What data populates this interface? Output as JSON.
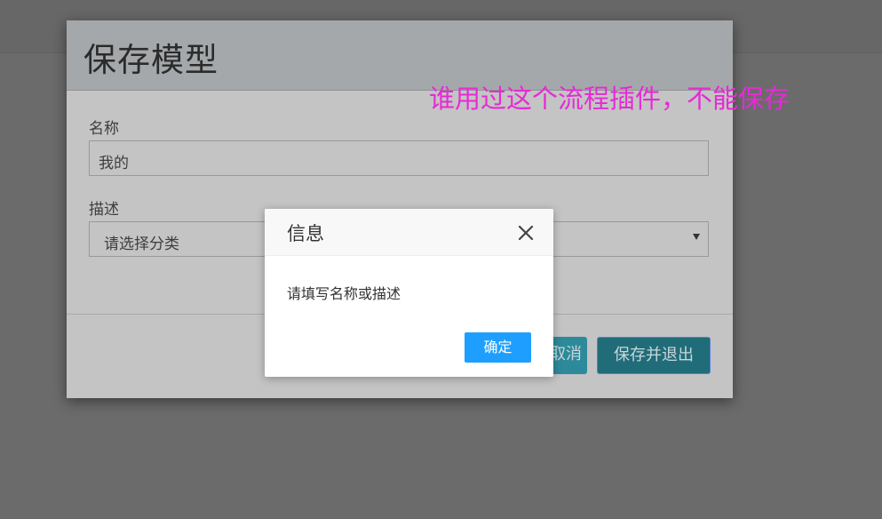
{
  "save_modal": {
    "title": "保存模型",
    "name_label": "名称",
    "name_value": "我的",
    "description_label": "描述",
    "category_select_value": "请选择分类",
    "cancel_label": "取消",
    "save_exit_label": "保存并退出"
  },
  "annotation": {
    "text": "谁用过这个流程插件，不能保存",
    "color": "#e62ad6"
  },
  "info_dialog": {
    "title": "信息",
    "close_icon": "close-icon",
    "message": "请填写名称或描述",
    "ok_label": "确定",
    "ok_color": "#1e9fff"
  }
}
